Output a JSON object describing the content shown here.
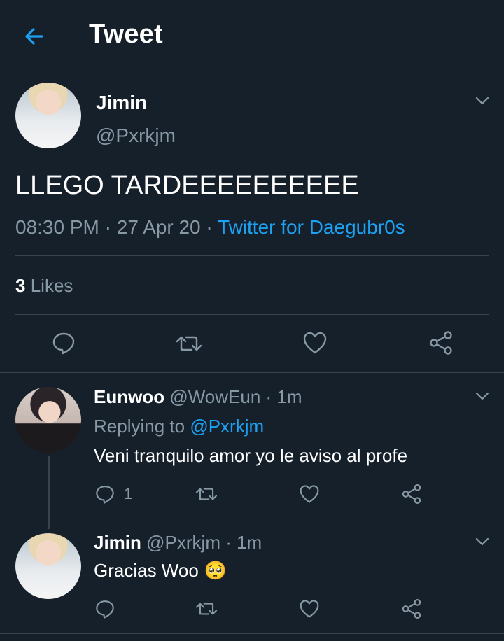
{
  "header": {
    "title": "Tweet"
  },
  "main_tweet": {
    "author_name": "Jimin",
    "author_handle": "@Pxrkjm",
    "text": "LLEGO TARDEEEEEEEEEE",
    "time": "08:30 PM",
    "date": "27 Apr 20",
    "source": "Twitter for Daegubr0s",
    "like_count": "3",
    "like_label": "Likes"
  },
  "replies": [
    {
      "name": "Eunwoo",
      "handle": "@WowEun",
      "time": "1m",
      "replying_to_label": "Replying to",
      "replying_to_handle": "@Pxrkjm",
      "text": "Veni tranquilo amor yo le aviso al profe",
      "reply_count": "1"
    },
    {
      "name": "Jimin",
      "handle": "@Pxrkjm",
      "time": "1m",
      "text": "Gracias Woo",
      "emoji": "🥺"
    }
  ],
  "colors": {
    "background": "#15202b",
    "accent": "#1da1f2",
    "muted": "#8899a6",
    "divider": "#38444d"
  },
  "icons": [
    "back-arrow-icon",
    "chevron-down-icon",
    "reply-icon",
    "retweet-icon",
    "like-icon",
    "share-icon"
  ]
}
